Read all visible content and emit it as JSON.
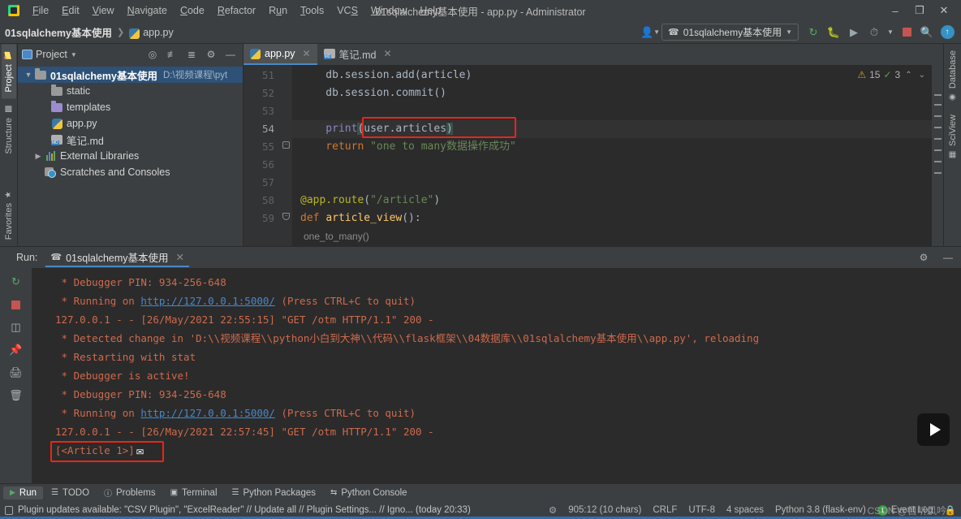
{
  "window": {
    "title": "01sqlalchemy基本使用 - app.py - Administrator",
    "minimize": "–",
    "maximize": "❐",
    "close": "✕"
  },
  "menu": {
    "items": [
      "File",
      "Edit",
      "View",
      "Navigate",
      "Code",
      "Refactor",
      "Run",
      "Tools",
      "VCS",
      "Window",
      "Help"
    ]
  },
  "navbar": {
    "breadcrumb_project": "01sqlalchemy基本使用",
    "breadcrumb_sep": "❯",
    "breadcrumb_file": "app.py",
    "run_config": "01sqlalchemy基本使用",
    "profile_icon": "user-profile-icon",
    "run_icon": "run-icon",
    "debug_icon": "debug-icon",
    "coverage_icon": "coverage-icon",
    "profiler_icon": "profiler-icon",
    "stop_icon": "stop-icon",
    "search_icon": "search-everywhere-icon",
    "updates_icon": "updates-available-icon"
  },
  "left_strip": {
    "tabs": [
      {
        "label": "Project",
        "active": true
      },
      {
        "label": "Structure",
        "active": false
      }
    ],
    "bottom_tabs": [
      {
        "label": "Favorites"
      }
    ]
  },
  "right_strip": {
    "tabs": [
      {
        "label": "Database"
      },
      {
        "label": "SciView"
      }
    ]
  },
  "project_panel": {
    "title": "Project",
    "header_icons": [
      "locate-icon",
      "expand-all-icon",
      "collapse-all-icon",
      "settings-gear-icon",
      "hide-icon"
    ],
    "tree": [
      {
        "label": "01sqlalchemy基本使用",
        "path": "D:\\视频课程\\pyt",
        "type": "root",
        "selected": true,
        "indent": 0,
        "expanded": true
      },
      {
        "label": "static",
        "type": "folder-gray",
        "indent": 1
      },
      {
        "label": "templates",
        "type": "folder-purple",
        "indent": 1
      },
      {
        "label": "app.py",
        "type": "python",
        "indent": 1
      },
      {
        "label": "笔记.md",
        "type": "markdown",
        "indent": 1
      },
      {
        "label": "External Libraries",
        "type": "libraries",
        "indent": 0,
        "collapsed": true
      },
      {
        "label": "Scratches and Consoles",
        "type": "scratches",
        "indent": 0
      }
    ]
  },
  "editor": {
    "tabs": [
      {
        "label": "app.py",
        "icon": "python-file-icon",
        "active": true,
        "close": "✕"
      },
      {
        "label": "笔记.md",
        "icon": "markdown-file-icon",
        "active": false,
        "close": "✕"
      }
    ],
    "inspection": {
      "warning_icon": "warning-triangle-icon",
      "warning_count": "15",
      "ok_icon": "inspection-ok-icon",
      "ok_count": "3",
      "up_arrow": "⌃",
      "down_arrow": "⌄"
    },
    "first_line_number": 51,
    "lines": [
      {
        "n": "51",
        "text": "    db.session.add(article)"
      },
      {
        "n": "52",
        "text": "    db.session.commit()"
      },
      {
        "n": "53",
        "text": ""
      },
      {
        "n": "54",
        "text": "    print(user.articles)",
        "current": true,
        "highlighted": true
      },
      {
        "n": "55",
        "text": "    return \"one to many数据操作成功\""
      },
      {
        "n": "56",
        "text": ""
      },
      {
        "n": "57",
        "text": ""
      },
      {
        "n": "58",
        "text": "@app.route(\"/article\")"
      },
      {
        "n": "59",
        "text": "def article_view():"
      }
    ],
    "ghost_line": "one_to_many()"
  },
  "run_panel": {
    "label": "Run:",
    "tab": "01sqlalchemy基本使用",
    "tab_close": "✕",
    "settings_icon": "gear-icon",
    "hide_icon": "hide-icon",
    "tools": [
      "rerun-icon",
      "stop-icon",
      "layout-icon",
      "pin-icon",
      "print-icon",
      "trash-icon",
      "scroll-up-icon",
      "scroll-down-icon",
      "soft-wrap-icon",
      "scroll-to-end-icon"
    ],
    "console": [
      {
        "text": " * Debugger PIN: 934-256-648"
      },
      {
        "pre": " * Running on ",
        "link": "http://127.0.0.1:5000/",
        "post": " (Press CTRL+C to quit)"
      },
      {
        "text": "127.0.0.1 - - [26/May/2021 22:55:15] \"GET /otm HTTP/1.1\" 200 -"
      },
      {
        "text": " * Detected change in 'D:\\\\视频课程\\\\python小白到大神\\\\代码\\\\flask框架\\\\04数据库\\\\01sqlalchemy基本使用\\\\app.py', reloading"
      },
      {
        "text": " * Restarting with stat"
      },
      {
        "text": " * Debugger is active!"
      },
      {
        "text": " * Debugger PIN: 934-256-648"
      },
      {
        "pre": " * Running on ",
        "link": "http://127.0.0.1:5000/",
        "post": " (Press CTRL+C to quit)"
      },
      {
        "text": "127.0.0.1 - - [26/May/2021 22:57:45] \"GET /otm HTTP/1.1\" 200 -"
      },
      {
        "text": "[<Article 1>]",
        "boxed": true
      }
    ]
  },
  "bottom_toolbar": {
    "items": [
      {
        "label": "Run",
        "icon": "run-icon",
        "active": true
      },
      {
        "label": "TODO",
        "icon": "todo-icon",
        "active": false
      },
      {
        "label": "Problems",
        "icon": "problems-icon",
        "active": false
      },
      {
        "label": "Terminal",
        "icon": "terminal-icon",
        "active": false
      },
      {
        "label": "Python Packages",
        "icon": "packages-icon",
        "active": false
      },
      {
        "label": "Python Console",
        "icon": "python-console-icon",
        "active": false
      }
    ]
  },
  "statusbar": {
    "message": "Plugin updates available: \"CSV Plugin\", \"ExcelReader\" // Update all // Plugin Settings... // Igno... (today 20:33)",
    "message_icon": "notification-icon",
    "caret": "905:12 (10 chars)",
    "line_separator": "CRLF",
    "encoding": "UTF-8",
    "indent": "4 spaces",
    "interpreter": "Python 3.8 (flask-env)",
    "event_log": "Event Log",
    "event_log_count": "1",
    "watermark": "CSDN @目听风吟"
  },
  "colors": {
    "accent_blue": "#4a88c7",
    "panel_bg": "#3c3f41",
    "editor_bg": "#2b2b2b",
    "console_red": "#cf6a4c",
    "highlight_red": "#e8261a",
    "selection_blue": "#2d5177",
    "green": "#59a869"
  }
}
